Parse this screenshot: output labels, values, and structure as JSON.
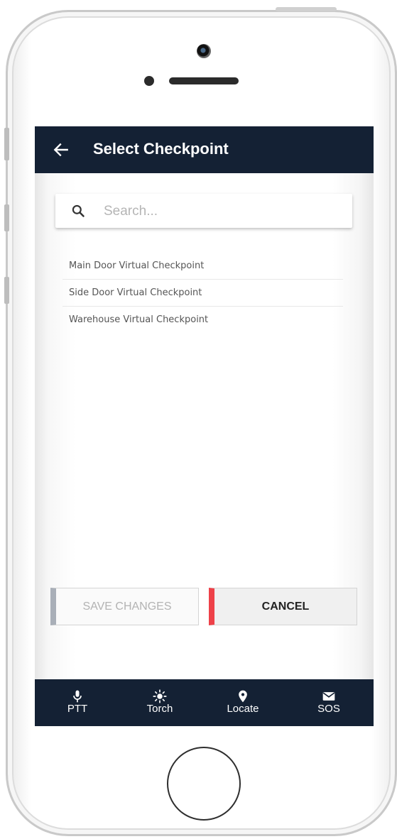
{
  "header": {
    "title": "Select Checkpoint",
    "back_icon": "arrow-left-icon"
  },
  "search": {
    "placeholder": "Search...",
    "value": "",
    "icon": "search-icon"
  },
  "checkpoints": [
    {
      "label": "Main Door Virtual Checkpoint"
    },
    {
      "label": "Side Door Virtual Checkpoint"
    },
    {
      "label": "Warehouse Virtual Checkpoint"
    }
  ],
  "actions": {
    "save_label": "SAVE CHANGES",
    "cancel_label": "CANCEL"
  },
  "bottom_nav": [
    {
      "label": "PTT",
      "icon": "microphone-icon"
    },
    {
      "label": "Torch",
      "icon": "sun-icon"
    },
    {
      "label": "Locate",
      "icon": "map-pin-icon"
    },
    {
      "label": "SOS",
      "icon": "envelope-icon"
    }
  ],
  "colors": {
    "header_bg": "#142134",
    "save_accent": "#a9afb8",
    "cancel_accent": "#ee4149"
  }
}
